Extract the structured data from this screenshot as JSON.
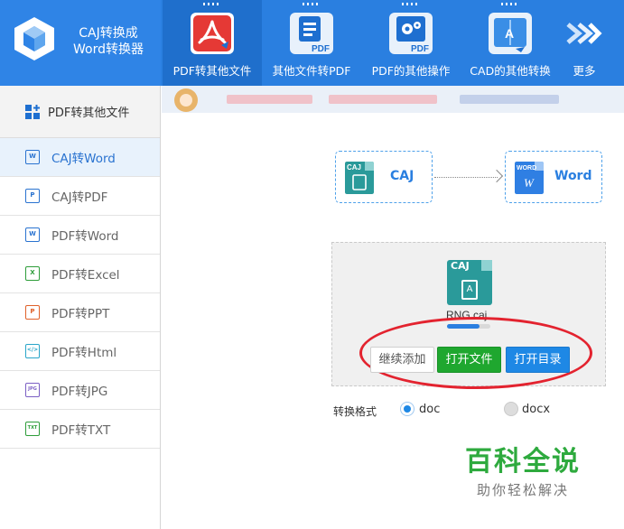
{
  "app": {
    "logo_line1": "CAJ转换成",
    "logo_line2": "Word转换器"
  },
  "toolbar": {
    "items": [
      {
        "label": "PDF转其他文件",
        "icon": "pdf-acrobat-icon",
        "color": "#e53935"
      },
      {
        "label": "其他文件转PDF",
        "icon": "document-to-pdf-icon",
        "color": "#1e6fd0"
      },
      {
        "label": "PDF的其他操作",
        "icon": "pdf-gears-icon",
        "color": "#1e6fd0"
      },
      {
        "label": "CAD的其他转换",
        "icon": "cad-convert-icon",
        "color": "#1e6fd0"
      },
      {
        "label": "更多",
        "icon": "double-chevron-right-icon"
      }
    ],
    "pdf_badge": "PDF",
    "cad_badge": "A"
  },
  "sidebar": {
    "header": "PDF转其他文件",
    "items": [
      {
        "label": "CAJ转Word",
        "icon": "word-doc-icon",
        "icon_text": "W",
        "active": true
      },
      {
        "label": "CAJ转PDF",
        "icon": "pdf-doc-icon",
        "icon_text": "P"
      },
      {
        "label": "PDF转Word",
        "icon": "word-file-icon",
        "icon_text": "W"
      },
      {
        "label": "PDF转Excel",
        "icon": "excel-file-icon",
        "icon_text": "X"
      },
      {
        "label": "PDF转PPT",
        "icon": "ppt-file-icon",
        "icon_text": "P"
      },
      {
        "label": "PDF转Html",
        "icon": "html-file-icon",
        "icon_text": "</>"
      },
      {
        "label": "PDF转JPG",
        "icon": "jpg-file-icon",
        "icon_text": "JPG"
      },
      {
        "label": "PDF转TXT",
        "icon": "txt-file-icon",
        "icon_text": "TXT"
      }
    ]
  },
  "conversion": {
    "from_label": "CAJ",
    "from_icon_text": "CAJ",
    "to_label": "Word",
    "to_icon_text": "WORD",
    "to_icon_letter": "W"
  },
  "file": {
    "badge": "CAJ",
    "name": "RNG.caj",
    "progress": 0.75,
    "book_letter": "A"
  },
  "buttons": {
    "add": "继续添加",
    "open_file": "打开文件",
    "open_dir": "打开目录"
  },
  "format": {
    "label": "转换格式",
    "options": [
      {
        "label": "doc",
        "selected": true
      },
      {
        "label": "docx",
        "selected": false
      }
    ]
  },
  "watermark": {
    "title": "百科全说",
    "subtitle": "助你轻松解决"
  },
  "colors": {
    "topbar": "#2a7fe0",
    "accent": "#1e88e5",
    "green": "#1fa72f",
    "highlight": "#e3232f"
  }
}
